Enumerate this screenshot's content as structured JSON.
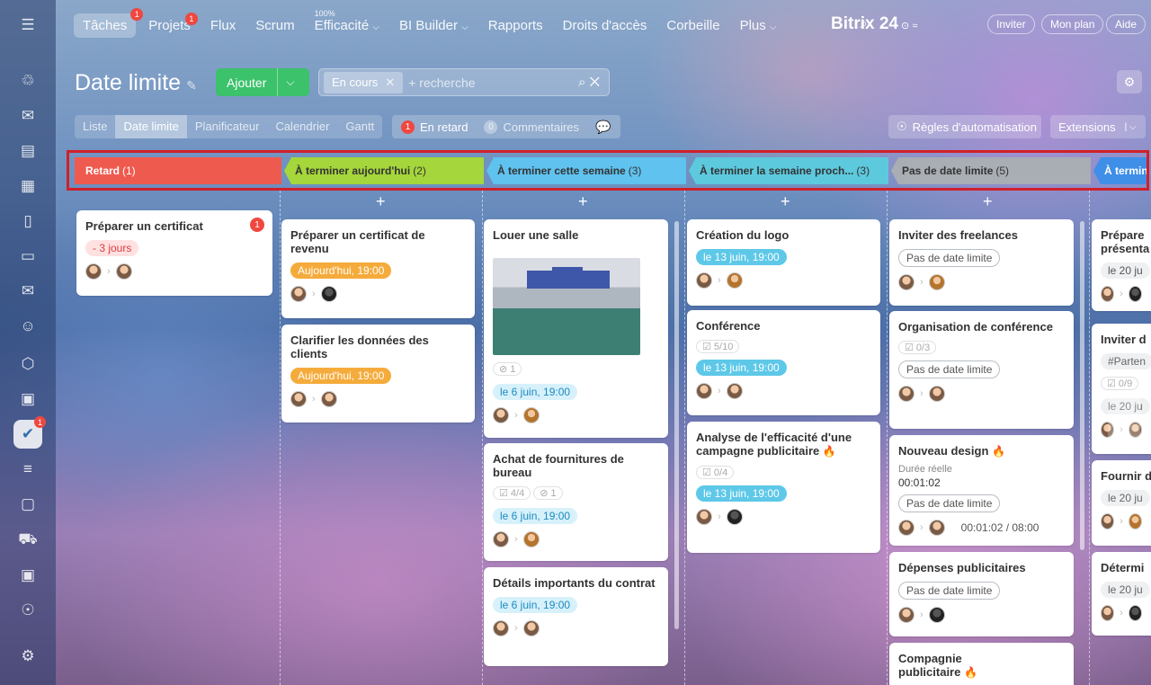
{
  "sidebar": {
    "items": [
      {
        "icon": "menu-icon",
        "glyph": "☰"
      },
      {
        "icon": "feed-icon",
        "glyph": "♲"
      },
      {
        "icon": "chat-icon",
        "glyph": "✉"
      },
      {
        "icon": "document-icon",
        "glyph": "▤"
      },
      {
        "icon": "calendar-icon",
        "glyph": "▦"
      },
      {
        "icon": "file-icon",
        "glyph": "▯"
      },
      {
        "icon": "drive-icon",
        "glyph": "▭"
      },
      {
        "icon": "mail-icon",
        "glyph": "✉"
      },
      {
        "icon": "groups-icon",
        "glyph": "☺"
      },
      {
        "icon": "crm-icon",
        "glyph": "⬡"
      },
      {
        "icon": "contact-center-icon",
        "glyph": "▣"
      },
      {
        "icon": "tasks-icon",
        "glyph": "✔",
        "badge": "1"
      },
      {
        "icon": "filter-icon",
        "glyph": "≡"
      },
      {
        "icon": "box-icon",
        "glyph": "▢"
      },
      {
        "icon": "cart-icon",
        "glyph": "⛟"
      },
      {
        "icon": "card-icon",
        "glyph": "▣"
      },
      {
        "icon": "robot-icon",
        "glyph": "☉"
      },
      {
        "icon": "settings-icon",
        "glyph": "⚙"
      }
    ]
  },
  "topnav": {
    "tasks": "Tâches",
    "tasks_badge": "1",
    "projects": "Projets",
    "projects_badge": "1",
    "flow": "Flux",
    "scrum": "Scrum",
    "efficiency": "Efficacité",
    "efficiency_pct": "100%",
    "bi": "BI Builder",
    "reports": "Rapports",
    "rights": "Droits d'accès",
    "trash": "Corbeille",
    "more": "Plus",
    "brand": "Bitrix 24",
    "invite": "Inviter",
    "plan": "Mon plan",
    "help": "Aide"
  },
  "toolbar": {
    "title": "Date limite",
    "add": "Ajouter",
    "filter_chip": "En cours",
    "search_placeholder": "+ recherche",
    "views": [
      "Liste",
      "Date limite",
      "Planificateur",
      "Calendrier",
      "Gantt"
    ],
    "overdue_count": "1",
    "overdue_label": "En retard",
    "comments_count": "0",
    "comments_label": "Commentaires",
    "automation": "Règles d'automatisation",
    "extensions": "Extensions"
  },
  "stages": [
    {
      "title": "Retard",
      "count": "(1)",
      "color": "#ef5a4f",
      "text": "#ffffff"
    },
    {
      "title": "À terminer aujourd'hui",
      "count": "(2)",
      "color": "#a5d63b",
      "text": "#333333"
    },
    {
      "title": "À terminer cette semaine",
      "count": "(3)",
      "color": "#5fc2ef",
      "text": "#333333"
    },
    {
      "title": "À terminer la semaine proch...",
      "count": "(3)",
      "color": "#5dc9dd",
      "text": "#333333"
    },
    {
      "title": "Pas de date limite",
      "count": "(5)",
      "color": "#a9adb4",
      "text": "#333333"
    },
    {
      "title": "À termin",
      "count": "",
      "color": "#3f8ee8",
      "text": "#ffffff"
    }
  ],
  "cards": {
    "c0_title": "Préparer un certificat",
    "c0_badge": "1",
    "c0_tag": "- 3 jours",
    "c1_title": "Préparer un certificat de revenu",
    "c1_tag": "Aujourd'hui, 19:00",
    "c2_title": "Clarifier les données des clients",
    "c2_tag": "Aujourd'hui, 19:00",
    "c3_title": "Louer une salle",
    "c3_files": "1",
    "c3_tag": "le 6 juin, 19:00",
    "c4_title": "Achat de fournitures de bureau",
    "c4_check": "4/4",
    "c4_files": "1",
    "c4_tag": "le 6 juin, 19:00",
    "c5_title": "Détails importants du contrat",
    "c5_tag": "le 6 juin, 19:00",
    "c6_title": "Création du logo",
    "c6_tag": "le 13 juin, 19:00",
    "c7_title": "Conférence",
    "c7_check": "5/10",
    "c7_tag": "le 13 juin, 19:00",
    "c8_title": "Analyse de l'efficacité d'une campagne publicitaire",
    "c8_check": "0/4",
    "c8_tag": "le 13 juin, 19:00",
    "c9_title": "Inviter des freelances",
    "c9_tag": "Pas de date limite",
    "c10_title": "Organisation de conférence",
    "c10_check": "0/3",
    "c10_tag": "Pas de date limite",
    "c11_title": "Nouveau design",
    "c11_lbl": "Durée réelle",
    "c11_time": "00:01:02",
    "c11_tag": "Pas de date limite",
    "c11_timer": "00:01:02 / 08:00",
    "c12_title": "Dépenses publicitaires",
    "c12_tag": "Pas de date limite",
    "c13_title": "Compagnie publicitaire",
    "c14_title": "Prépare présenta",
    "c14_tag": "le 20 ju",
    "c15_title": "Inviter d",
    "c15_tag2": "#Parten",
    "c15_check": "0/9",
    "c15_tag": "le 20 ju",
    "c16_title": "Fournir d",
    "c16_tag": "le 20 ju",
    "c17_title": "Détermi",
    "c17_tag": "le 20 ju"
  }
}
